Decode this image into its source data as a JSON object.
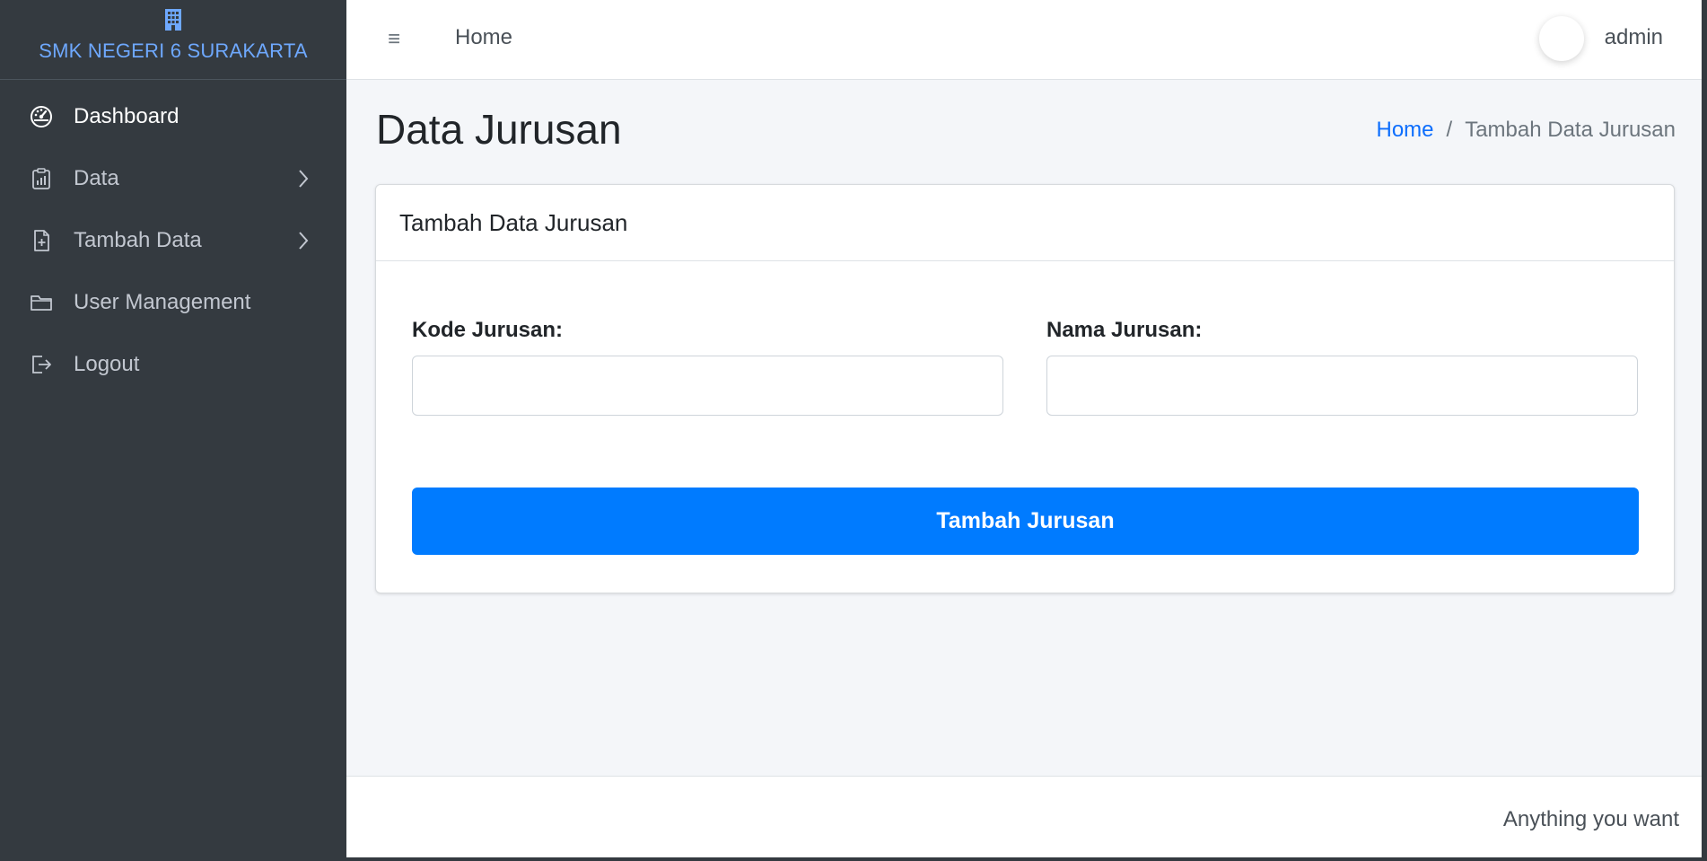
{
  "brand": {
    "name": "SMK NEGERI 6 SURAKARTA",
    "icon": "building-icon",
    "color": "#6ea8fe"
  },
  "sidebar": {
    "items": [
      {
        "label": "Dashboard",
        "icon": "dashboard-gauge-icon",
        "active": true
      },
      {
        "label": "Data",
        "icon": "clipboard-chart-icon",
        "has_children": true
      },
      {
        "label": "Tambah Data",
        "icon": "file-plus-icon",
        "has_children": true
      },
      {
        "label": "User Management",
        "icon": "folder-icon"
      },
      {
        "label": "Logout",
        "icon": "logout-icon"
      }
    ]
  },
  "topbar": {
    "menu_icon": "hamburger-icon",
    "home_label": "Home",
    "user_name": "admin"
  },
  "content": {
    "title": "Data Jurusan",
    "breadcrumb": {
      "home": "Home",
      "separator": "/",
      "current": "Tambah Data Jurusan"
    }
  },
  "card": {
    "header": "Tambah Data Jurusan",
    "fields": [
      {
        "label": "Kode Jurusan:",
        "value": "",
        "placeholder": ""
      },
      {
        "label": "Nama Jurusan:",
        "value": "",
        "placeholder": ""
      }
    ],
    "submit_label": "Tambah Jurusan",
    "submit_color": "#007bff"
  },
  "footer": {
    "text": "Anything you want"
  }
}
